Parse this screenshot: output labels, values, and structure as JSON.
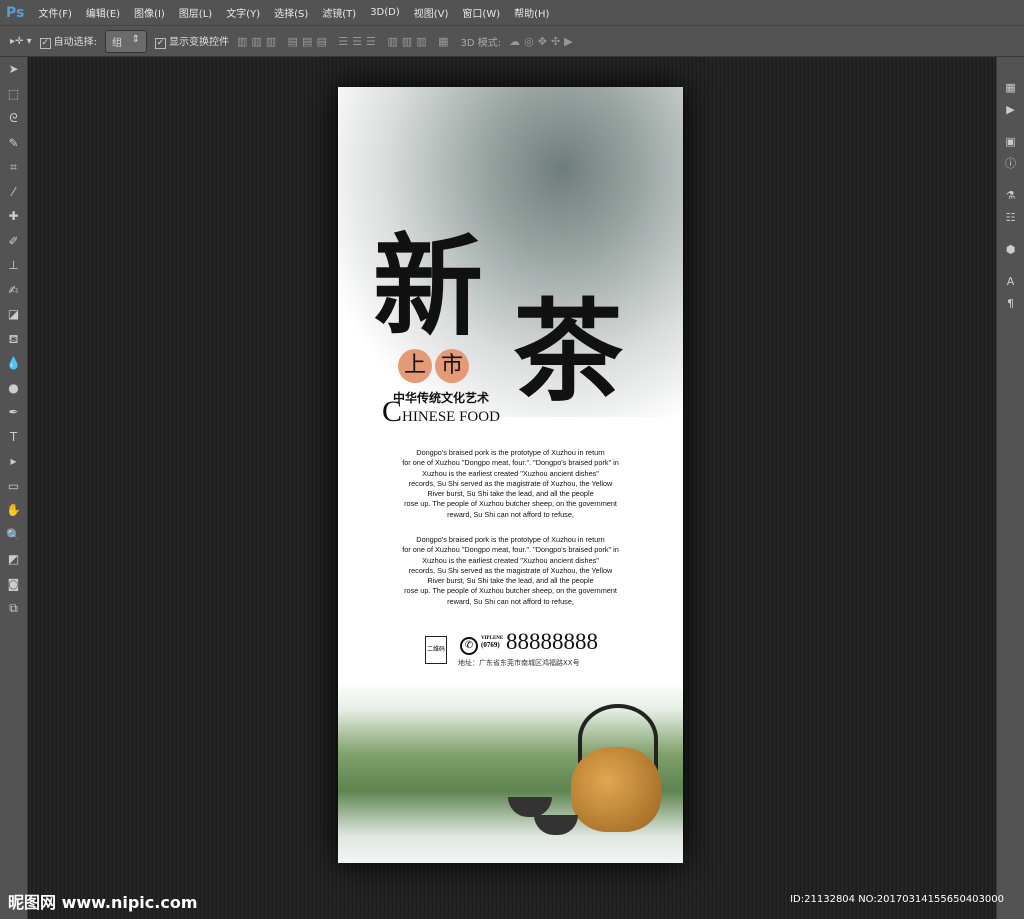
{
  "app": {
    "logo": "Ps",
    "menu": [
      "文件(F)",
      "编辑(E)",
      "图像(I)",
      "图层(L)",
      "文字(Y)",
      "选择(S)",
      "滤镜(T)",
      "3D(D)",
      "视图(V)",
      "窗口(W)",
      "帮助(H)"
    ]
  },
  "options": {
    "auto_select_label": "自动选择:",
    "auto_select_checked": true,
    "auto_select_value": "组",
    "show_transform_label": "显示变换控件",
    "show_transform_checked": true,
    "mode_3d_label": "3D 模式:"
  },
  "poster": {
    "title_char1": "新",
    "title_char2": "茶",
    "badge1": "上",
    "badge2": "市",
    "subtitle_cn": "中华传统文化艺术",
    "subtitle_en_initial": "C",
    "subtitle_en_rest": "HINESE FOOD",
    "paragraph_lines": [
      "Dongpo's braised pork is the prototype of Xuzhou in return",
      "for one of Xuzhou \"Dongpo meat, four.\". \"Dongpo's braised pork\" in",
      "Xuzhou is the earliest created \"Xuzhou ancient dishes\"",
      "records, Su Shi served as the magistrate of Xuzhou, the Yellow",
      "River burst, Su Shi take the lead, and all the people",
      "rose up. The people of Xuzhou butcher sheep, on the government",
      "reward, Su Shi can not afford to refuse,"
    ],
    "qr_label": "二维码",
    "vip_label": "VIPLENE",
    "area_code": "(0769)",
    "phone": "88888888",
    "address": "地址：广东省东莞市南城区鸿福路XX号"
  },
  "watermark": {
    "logo": "昵图网 www.nipic.com",
    "id": "ID:21132804 NO:20170314155650403000"
  }
}
